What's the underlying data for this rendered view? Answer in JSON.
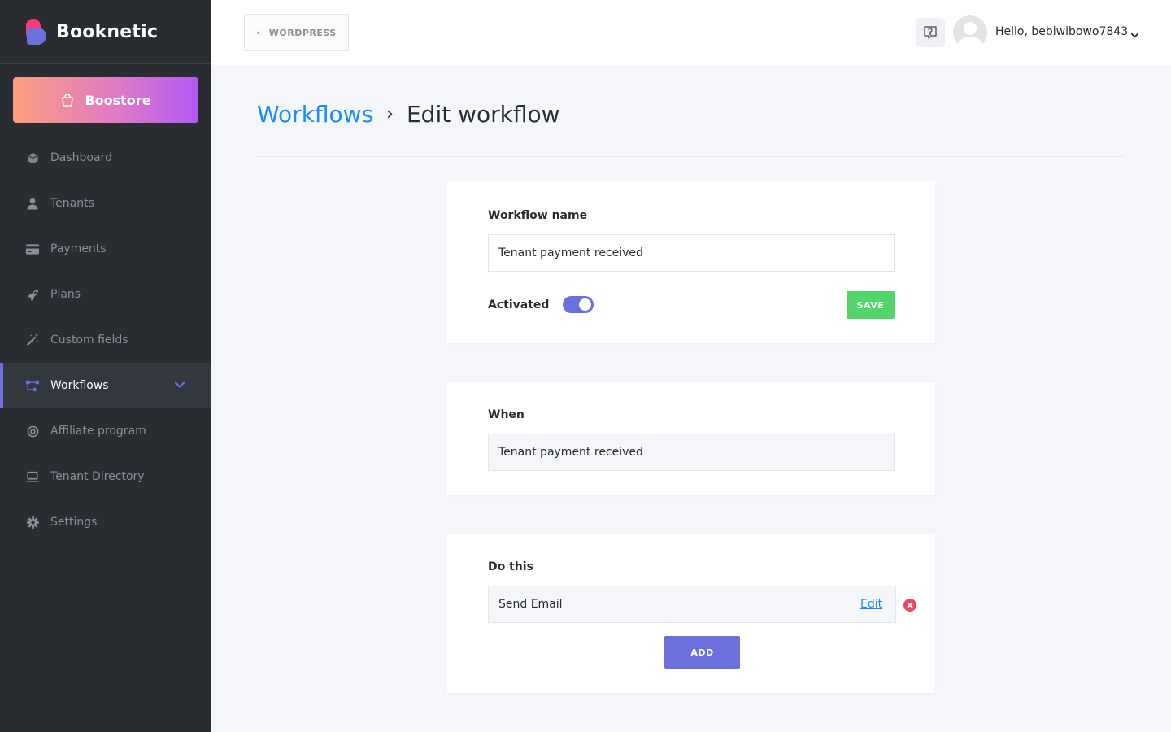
{
  "brand": {
    "name": "Booknetic"
  },
  "sidebar": {
    "boostore_label": "Boostore",
    "items": [
      {
        "label": "Dashboard",
        "icon": "box-icon"
      },
      {
        "label": "Tenants",
        "icon": "user-icon"
      },
      {
        "label": "Payments",
        "icon": "credit-card-icon"
      },
      {
        "label": "Plans",
        "icon": "rocket-icon"
      },
      {
        "label": "Custom fields",
        "icon": "magic-wand-icon"
      },
      {
        "label": "Workflows",
        "icon": "workflow-icon",
        "active": true
      },
      {
        "label": "Affiliate program",
        "icon": "target-icon"
      },
      {
        "label": "Tenant Directory",
        "icon": "laptop-icon"
      },
      {
        "label": "Settings",
        "icon": "gear-icon"
      }
    ]
  },
  "header": {
    "back_label": "WORDPRESS",
    "greeting": "Hello, bebiwibowo7843"
  },
  "breadcrumb": {
    "parent": "Workflows",
    "separator": "›",
    "current": "Edit workflow"
  },
  "workflow": {
    "name_label": "Workflow name",
    "name_value": "Tenant payment received",
    "activated_label": "Activated",
    "activated": true,
    "save_label": "SAVE"
  },
  "when": {
    "label": "When",
    "value": "Tenant payment received"
  },
  "do_this": {
    "label": "Do this",
    "actions": [
      {
        "name": "Send Email",
        "edit_label": "Edit"
      }
    ],
    "add_label": "ADD"
  },
  "colors": {
    "sidebar_bg": "#292d32",
    "accent": "#6c70dc",
    "link": "#1a8cff",
    "save": "#53d56c",
    "danger": "#f0475f"
  }
}
